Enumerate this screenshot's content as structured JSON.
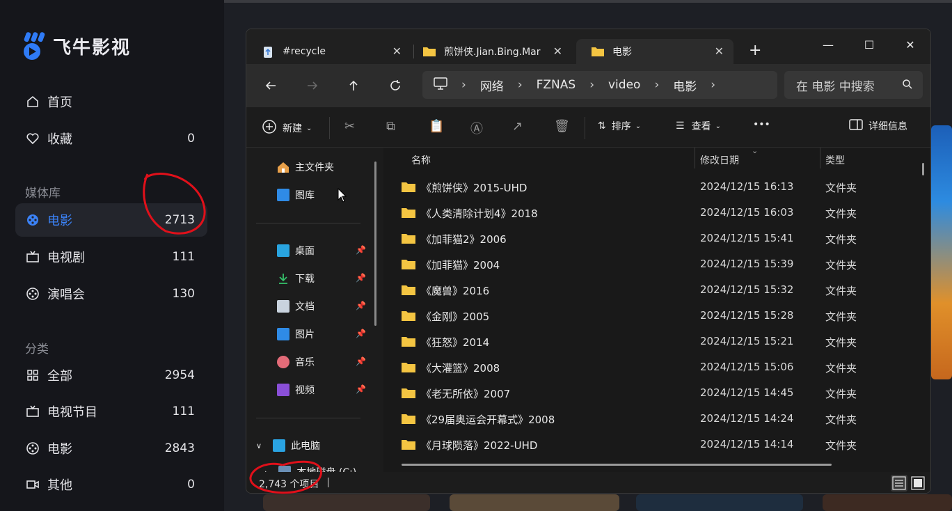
{
  "app": {
    "name": "飞牛影视",
    "nav": [
      {
        "label": "首页",
        "count": ""
      },
      {
        "label": "收藏",
        "count": "0"
      }
    ],
    "library_section": "媒体库",
    "library": [
      {
        "label": "电影",
        "count": "2713"
      },
      {
        "label": "电视剧",
        "count": "111"
      },
      {
        "label": "演唱会",
        "count": "130"
      }
    ],
    "category_section": "分类",
    "categories": [
      {
        "label": "全部",
        "count": "2954"
      },
      {
        "label": "电视节目",
        "count": "111"
      },
      {
        "label": "电影",
        "count": "2843"
      },
      {
        "label": "其他",
        "count": "0"
      }
    ]
  },
  "explorer": {
    "tabs": [
      {
        "label": "#recycle",
        "close": "✕"
      },
      {
        "label": "煎饼侠.Jian.Bing.Mar",
        "close": "✕"
      },
      {
        "label": "电影",
        "close": "✕"
      }
    ],
    "new_tab": "+",
    "window_controls": {
      "minimize": "—",
      "maximize": "☐",
      "close": "✕"
    },
    "breadcrumb": [
      "网络",
      "FZNAS",
      "video",
      "电影"
    ],
    "crumb_separator": "›",
    "search_placeholder": "在 电影 中搜索",
    "commands": {
      "new": "新建",
      "sort": "排序",
      "view": "查看",
      "more": "•••",
      "details": "详细信息"
    },
    "nav_pane": {
      "pinned_top": [
        {
          "label": "主文件夹",
          "icon": "home-icon"
        },
        {
          "label": "图库",
          "icon": "gallery-icon"
        }
      ],
      "quick_access": [
        {
          "label": "桌面",
          "icon": "desktop-icon"
        },
        {
          "label": "下载",
          "icon": "download-icon"
        },
        {
          "label": "文档",
          "icon": "document-icon"
        },
        {
          "label": "图片",
          "icon": "pictures-icon"
        },
        {
          "label": "音乐",
          "icon": "music-icon"
        },
        {
          "label": "视频",
          "icon": "video-icon"
        }
      ],
      "this_pc": "此电脑",
      "local_disk": "本地磁盘 (C:)"
    },
    "columns": {
      "name": "名称",
      "date": "修改日期",
      "type": "类型"
    },
    "files": [
      {
        "name": "《煎饼侠》2015-UHD",
        "date": "2024/12/15 16:13",
        "type": "文件夹"
      },
      {
        "name": "《人类清除计划4》2018",
        "date": "2024/12/15 16:03",
        "type": "文件夹"
      },
      {
        "name": "《加菲猫2》2006",
        "date": "2024/12/15 15:41",
        "type": "文件夹"
      },
      {
        "name": "《加菲猫》2004",
        "date": "2024/12/15 15:39",
        "type": "文件夹"
      },
      {
        "name": "《魔兽》2016",
        "date": "2024/12/15 15:32",
        "type": "文件夹"
      },
      {
        "name": "《金刚》2005",
        "date": "2024/12/15 15:28",
        "type": "文件夹"
      },
      {
        "name": "《狂怒》2014",
        "date": "2024/12/15 15:21",
        "type": "文件夹"
      },
      {
        "name": "《大灌篮》2008",
        "date": "2024/12/15 15:06",
        "type": "文件夹"
      },
      {
        "name": "《老无所依》2007",
        "date": "2024/12/15 14:45",
        "type": "文件夹"
      },
      {
        "name": "《29届奥运会开幕式》2008",
        "date": "2024/12/15 14:24",
        "type": "文件夹"
      },
      {
        "name": "《月球陨落》2022-UHD",
        "date": "2024/12/15 14:14",
        "type": "文件夹"
      }
    ],
    "status": "2,743 个项目"
  },
  "colors": {
    "accent": "#3b82f6",
    "folder": "#f4c542",
    "annotation": "#e0101a"
  }
}
